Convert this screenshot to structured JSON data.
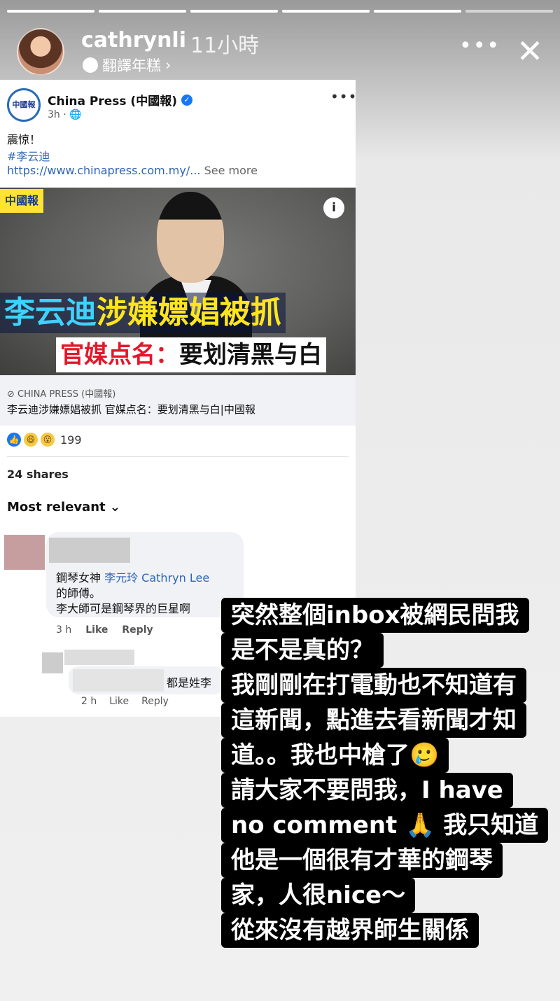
{
  "story": {
    "progress": {
      "total": 6,
      "current": 5
    },
    "username": "cathrynli",
    "time": "11小時",
    "translate_label": "翻譯年糕",
    "translate_chevron": "›",
    "more_icon": "•••",
    "close_icon": "✕"
  },
  "post": {
    "page_logo_text": "中國報",
    "page_name": "China Press (中國報)",
    "verified_icon": "✓",
    "meta": "3h · 🌐",
    "more_icon": "•••",
    "text_line1": "震惊！",
    "hashtag": "#李云迪",
    "link_text": "https://www.chinapress.com.my/...",
    "see_more": "See more",
    "image": {
      "logo_text": "中國報",
      "info_icon": "i",
      "headline_part1": "李云迪",
      "headline_part2": "涉嫌嫖娼被抓",
      "headline2_part1": "官媒点名：",
      "headline2_part2": "要划清黑与白"
    },
    "source_label": "⊘ CHINA PRESS (中國報)",
    "link_title": "李云迪涉嫌嫖娼被抓 官媒点名：要划清黑与白|中國報",
    "reactions_count": "199",
    "shares": "24 shares",
    "sort_label": "Most relevant ⌄"
  },
  "comments": [
    {
      "line1": "鋼琴女神 ",
      "mention": "李元玲 Cathryn Lee",
      "line2": "的師傅。",
      "line3": "李大師可是鋼琴界的巨星啊",
      "time": "3 h",
      "like": "Like",
      "reply": "Reply"
    },
    {
      "text": "都是姓李",
      "time": "2 h",
      "like": "Like",
      "reply": "Reply"
    }
  ],
  "overlay_lines": [
    "突然整個inbox被網民問我",
    "是不是真的？",
    "我剛剛在打電動也不知道有",
    "這新聞，點進去看新聞才知",
    "道。。我也中槍了🥲",
    "請大家不要問我，I have",
    "no comment 🙏 我只知道",
    "他是一個很有才華的鋼琴",
    "家，人很nice～",
    "從來沒有越界師生關係"
  ]
}
